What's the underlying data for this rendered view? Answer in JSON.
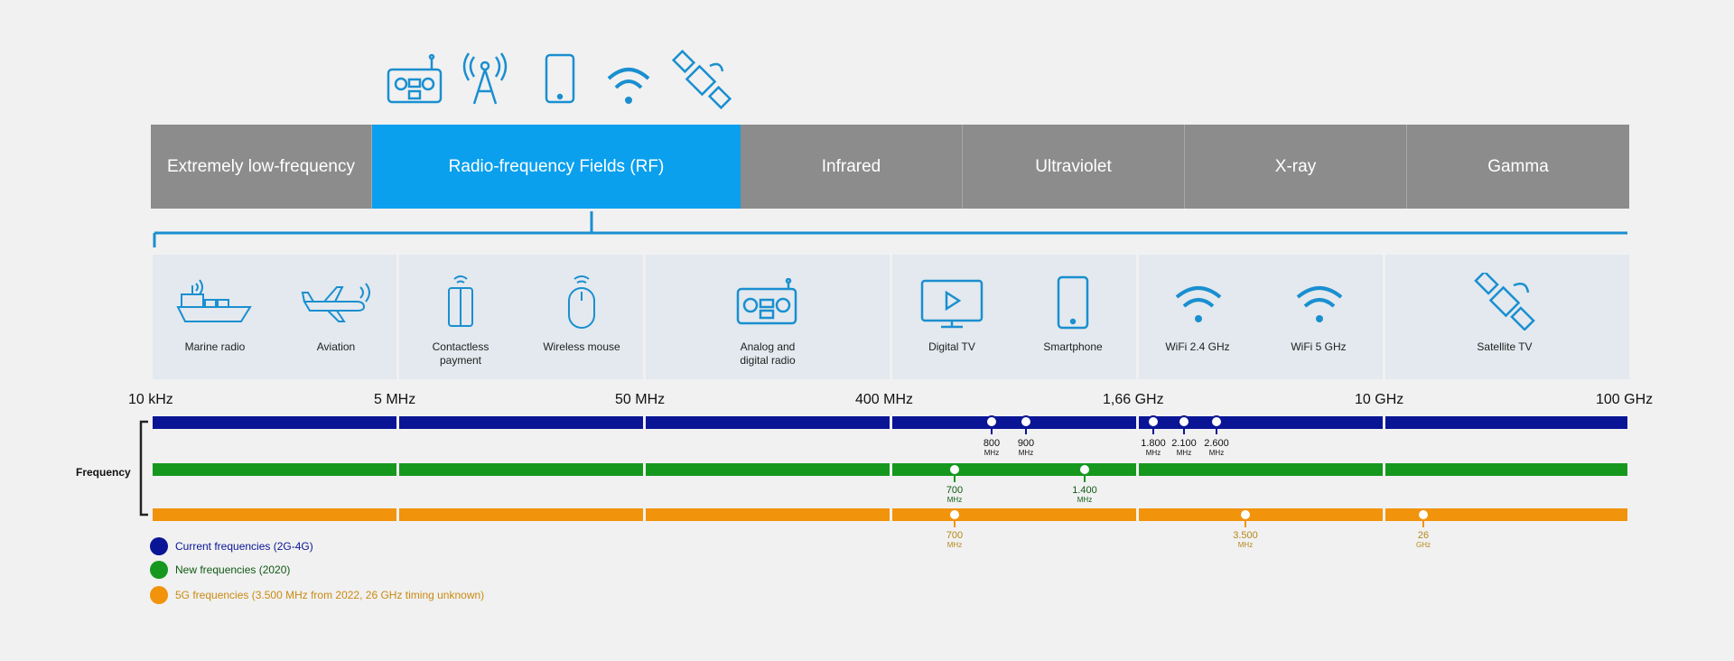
{
  "spectrum": {
    "bands": [
      "Extremely low-frequency",
      "Radio-frequency Fields (RF)",
      "Infrared",
      "Ultraviolet",
      "X-ray",
      "Gamma"
    ]
  },
  "applications": [
    "Marine radio",
    "Aviation",
    "Contactless payment",
    "Wireless mouse",
    "Analog and digital radio",
    "Digital TV",
    "Smartphone",
    "WiFi 2.4 GHz",
    "WiFi 5 GHz",
    "Satellite TV"
  ],
  "scale": [
    "10 kHz",
    "5 MHz",
    "50 MHz",
    "400 MHz",
    "1,66 GHz",
    "10 GHz",
    "100 GHz"
  ],
  "frequency_label": "Frequency",
  "markers": {
    "current": [
      {
        "value": "800",
        "unit": "MHz"
      },
      {
        "value": "900",
        "unit": "MHz"
      },
      {
        "value": "1.800",
        "unit": "MHz"
      },
      {
        "value": "2.100",
        "unit": "MHz"
      },
      {
        "value": "2.600",
        "unit": "MHz"
      }
    ],
    "new": [
      {
        "value": "700",
        "unit": "MHz"
      },
      {
        "value": "1.400",
        "unit": "MHz"
      }
    ],
    "fiveg": [
      {
        "value": "700",
        "unit": "MHz"
      },
      {
        "value": "3.500",
        "unit": "MHz"
      },
      {
        "value": "26",
        "unit": "GHz"
      }
    ]
  },
  "legend": {
    "current": "Current frequencies (2G-4G)",
    "new": "New frequencies (2020)",
    "fiveg": "5G frequencies (3.500 MHz from 2022, 26 GHz timing unknown)"
  },
  "colors": {
    "rf": "#0aa0ee",
    "gray_band": "#8c8c8c",
    "icon": "#1a8fd0",
    "current": "#0a1596",
    "new": "#16981f",
    "fiveg": "#f2930c",
    "fiveg_text": "#b5871a",
    "new_text": "#0f5a14"
  }
}
